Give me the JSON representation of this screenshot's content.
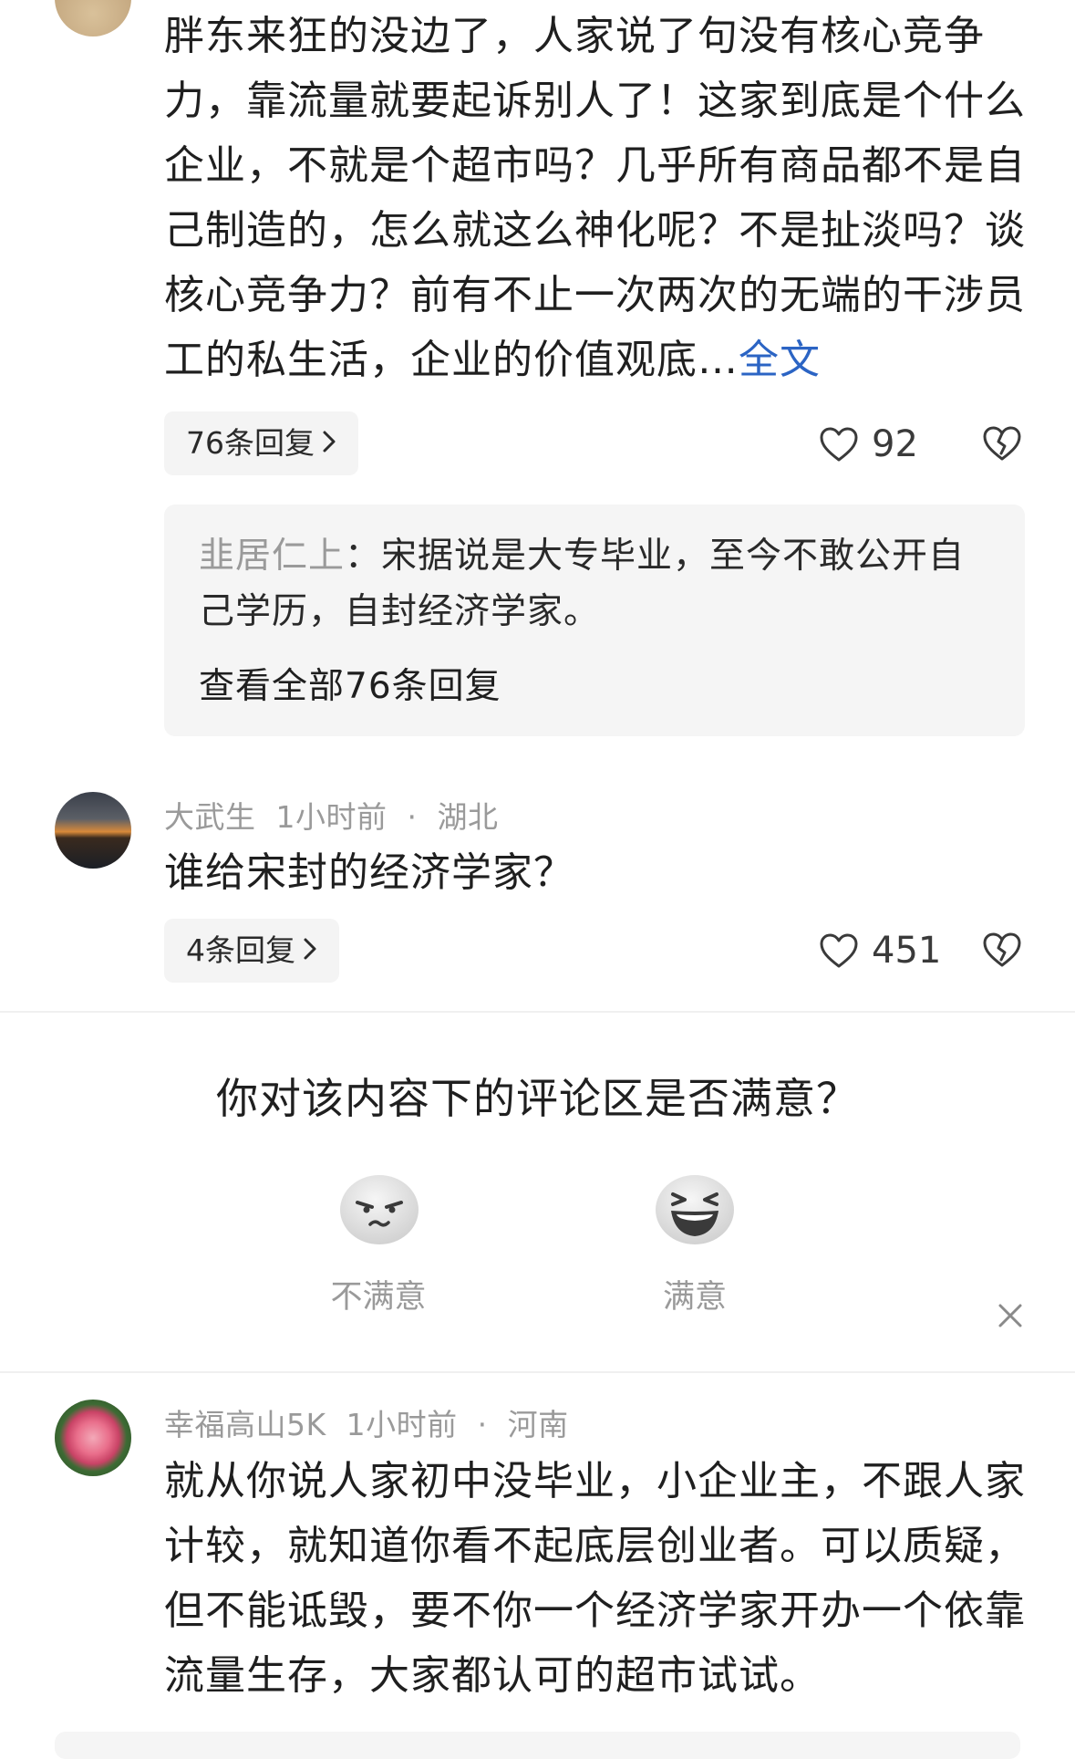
{
  "comments": [
    {
      "text": "胖东来狂的没边了，人家说了句没有核心竞争力，靠流量就要起诉别人了！这家到底是个什么企业，不就是个超市吗？几乎所有商品都不是自己制造的，怎么就这么神化呢？不是扯淡吗？谈核心竞争力？前有不止一次两次的无端的干涉员工的私生活，企业的价值观底…",
      "full_text_link": "全文",
      "reply_count_label": "76条回复",
      "likes": "92",
      "pinned_reply": {
        "author": "韭居仁上",
        "separator": "：",
        "text": "宋据说是大专毕业，至今不敢公开自己学历，自封经济学家。",
        "view_all": "查看全部76条回复"
      }
    },
    {
      "username": "大武生",
      "time": "1小时前",
      "dot": "·",
      "location": "湖北",
      "text": "谁给宋封的经济学家？",
      "reply_count_label": "4条回复",
      "likes": "451"
    },
    {
      "username": "幸福高山5K",
      "time": "1小时前",
      "dot": "·",
      "location": "河南",
      "text": "就从你说人家初中没毕业，小企业主，不跟人家计较，就知道你看不起底层创业者。可以质疑，但不能诋毁，要不你一个经济学家开办一个依靠流量生存，大家都认可的超市试试。"
    }
  ],
  "survey": {
    "question": "你对该内容下的评论区是否满意？",
    "unsatisfied_label": "不满意",
    "satisfied_label": "满意"
  },
  "icons": {
    "like": "heart-outline-icon",
    "dislike": "broken-heart-icon",
    "chevron": "chevron-right-icon",
    "close": "close-icon"
  },
  "colors": {
    "link": "#2b64c4",
    "meta": "#9a9a9a",
    "chip_bg": "#f4f4f4"
  }
}
